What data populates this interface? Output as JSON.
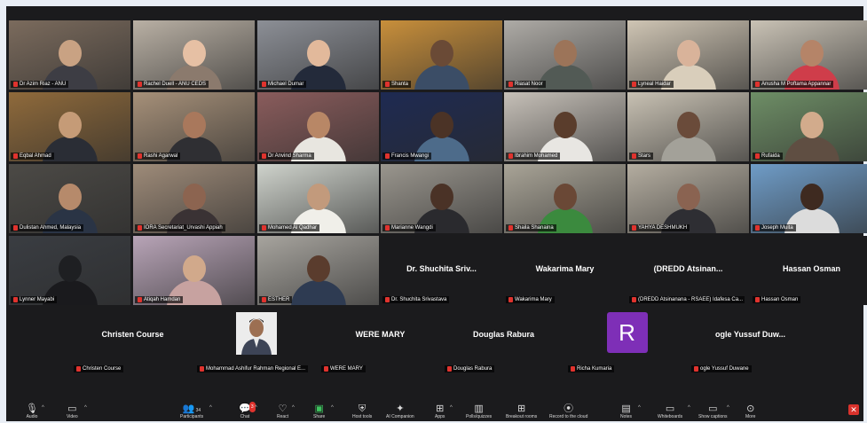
{
  "colors": {
    "muted": "#e0332e",
    "active_border": "#47d36a",
    "avatar_r": "#7e2fb7",
    "end_button": "#d9322c",
    "background": "#1b1b1d"
  },
  "tiles": [
    {
      "name": "Dr Azim Riaz - ANU",
      "bg": "#7b6b5d",
      "skin": "#c9a283",
      "shirt": "#3d3d44"
    },
    {
      "name": "Rachel Duell - ANU CEDS",
      "bg": "#b9b0a4",
      "skin": "#e6c0a4",
      "shirt": "#8b7a6d"
    },
    {
      "name": "Michael Dumar",
      "bg": "#8c8f96",
      "skin": "#e2b99b",
      "shirt": "#232a3a"
    },
    {
      "name": "Shanta",
      "bg": "#c88f3b",
      "skin": "#6a4a36",
      "shirt": "#3b4d66"
    },
    {
      "name": "Riasat Noor",
      "bg": "#aeaba6",
      "skin": "#9c7459",
      "shirt": "#525a55"
    },
    {
      "name": "Lyneal Haidar",
      "bg": "#cfc5b4",
      "skin": "#d9b39a",
      "shirt": "#d9cebb"
    },
    {
      "name": "Anusha M Poftama Appannar",
      "bg": "#c9c2b5",
      "skin": "#b58468",
      "shirt": "#cf3d4a"
    },
    {
      "name": "Eqbal Ahmad",
      "bg": "#8f6a3b",
      "skin": "#c59b77",
      "shirt": "#2a2d35"
    },
    {
      "name": "Rashi Agarwal",
      "bg": "#a69079",
      "skin": "#a9785c",
      "shirt": "#2f2f33"
    },
    {
      "name": "Dr Anvind Sharma",
      "bg": "#8a5c5c",
      "skin": "#b88766",
      "shirt": "#e8e6e0"
    },
    {
      "name": "Francis Mwangi",
      "bg": "#1e2a52",
      "skin": "#4b3326",
      "shirt": "#4d6b8a"
    },
    {
      "name": "Ibrahim Mohamed",
      "bg": "#c6c0b8",
      "skin": "#5a3d2c",
      "shirt": "#e8e6e2"
    },
    {
      "name": "Stars",
      "bg": "#c8c1b3",
      "skin": "#6a4b3a",
      "shirt": "#a3a199"
    },
    {
      "name": "Rufaida",
      "bg": "#6e8e66",
      "skin": "#d2ab8c",
      "shirt": "#5f4e42"
    },
    {
      "name": "Dulistan Ahmed, Malaysia",
      "bg": "#4c4a46",
      "skin": "#b68a6b",
      "shirt": "#2a3445"
    },
    {
      "name": "IORA Secretariat_Urvashi Appiah",
      "bg": "#9e8b79",
      "skin": "#8c6450",
      "shirt": "#3a3234"
    },
    {
      "name": "Mohamed Al Qadhar",
      "bg": "#cfd3cc",
      "skin": "#c29a7c",
      "shirt": "#f0efe9"
    },
    {
      "name": "Marianne Wangdi",
      "bg": "#9a968e",
      "skin": "#4a3226",
      "shirt": "#2a2a2e"
    },
    {
      "name": "Shaila Shanaina",
      "bg": "#a9a497",
      "skin": "#6a4836",
      "shirt": "#3b8a3e"
    },
    {
      "name": "YAHYA DESHMUKH",
      "bg": "#b4ada0",
      "skin": "#8a6351",
      "shirt": "#2e2e33"
    },
    {
      "name": "Joseph Muita",
      "bg": "#6f9cc7",
      "skin": "#3e2a20",
      "shirt": "#dcdcdc"
    },
    {
      "name": "Lynner Mayabi",
      "bg": "#3a3d42",
      "skin": "#1e1f22",
      "shirt": "#1a1a1d"
    },
    {
      "name": "Atiqah Hamdan",
      "bg": "#b8a4b7",
      "skin": "#d1a98b",
      "shirt": "#c7a2a0"
    },
    {
      "name": "ESTHER",
      "bg": "#a7a49e",
      "skin": "#5a3c2d",
      "shirt": "#2e3b52"
    }
  ],
  "name_tiles": [
    {
      "big": "Dr. Shuchita Sriv...",
      "small": "Dr. Shuchita Srivastava"
    },
    {
      "big": "Wakarima Mary",
      "small": "Wakarima Mary"
    },
    {
      "big": "(DREDD  Atsinan...",
      "small": "(DREDD Atsinanana - RSAEE) Idafesa Ca..."
    },
    {
      "big": "Hassan Osman",
      "small": "Hassan Osman"
    }
  ],
  "row5": [
    {
      "type": "name",
      "big": "Christen Course",
      "small": "Christen Course"
    },
    {
      "type": "photo",
      "small": "Mohammad Ashifur Rahman Regional E..."
    },
    {
      "type": "name",
      "big": "WERE MARY",
      "small": "WERE MARY"
    },
    {
      "type": "name",
      "big": "Douglas Rabura",
      "small": "Douglas Rabura"
    },
    {
      "type": "avatar",
      "letter": "R",
      "small": "Richa Kumaria"
    },
    {
      "type": "name",
      "big": "ogle Yussuf Duw...",
      "small": "ogle Yussuf Duwane"
    }
  ],
  "toolbar": {
    "audio": {
      "label": "Audio",
      "icon": "microphone-icon"
    },
    "video": {
      "label": "Video",
      "icon": "video-camera-icon"
    },
    "participants": {
      "label": "Participants",
      "count": "34",
      "icon": "people-icon"
    },
    "chat": {
      "label": "Chat",
      "badge": "3",
      "icon": "chat-icon"
    },
    "react": {
      "label": "React",
      "icon": "heart-icon"
    },
    "share": {
      "label": "Share",
      "icon": "share-icon"
    },
    "host_tools": {
      "label": "Host tools",
      "icon": "shield-icon"
    },
    "ai_companion": {
      "label": "AI Companion",
      "icon": "sparkle-icon"
    },
    "apps": {
      "label": "Apps",
      "icon": "apps-icon"
    },
    "polls": {
      "label": "Polls/quizzes",
      "icon": "poll-icon"
    },
    "breakout": {
      "label": "Breakout rooms",
      "icon": "grid-icon"
    },
    "record": {
      "label": "Record to the cloud",
      "icon": "record-icon"
    },
    "notes": {
      "label": "Notes",
      "icon": "notes-icon"
    },
    "whiteboards": {
      "label": "Whiteboards",
      "icon": "whiteboard-icon"
    },
    "captions": {
      "label": "Show captions",
      "icon": "captions-icon"
    },
    "more": {
      "label": "More",
      "icon": "more-icon"
    },
    "end": {
      "label": "End",
      "icon": "end-icon"
    }
  }
}
